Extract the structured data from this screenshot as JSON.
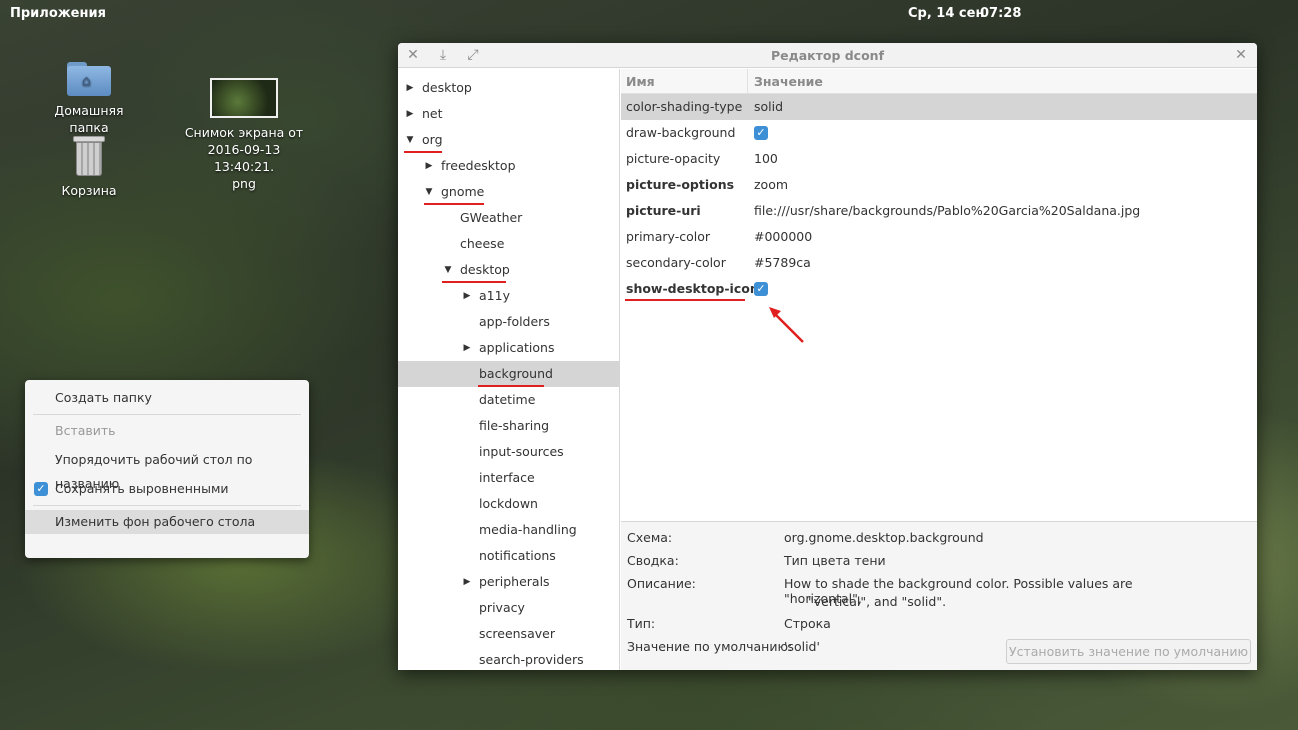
{
  "top_panel": {
    "apps": "Приложения",
    "date": "Ср, 14 сен",
    "time": "07:28"
  },
  "desktop_icons": {
    "home": "Домашняя папка",
    "trash": "Корзина",
    "screenshot_line1": "Снимок экрана от",
    "screenshot_line2": "2016-09-13 13:40:21.",
    "screenshot_line3": "png"
  },
  "context_menu": {
    "create_folder": "Создать папку",
    "paste": "Вставить",
    "arrange": "Упорядочить рабочий стол по названию",
    "keep_aligned": "Сохранять выровненными",
    "change_bg": "Изменить фон рабочего стола"
  },
  "window": {
    "title": "Редактор dconf"
  },
  "tree": [
    "desktop",
    "net",
    "org",
    "freedesktop",
    "gnome",
    "GWeather",
    "cheese",
    "desktop",
    "a11y",
    "app-folders",
    "applications",
    "background",
    "datetime",
    "file-sharing",
    "input-sources",
    "interface",
    "lockdown",
    "media-handling",
    "notifications",
    "peripherals",
    "privacy",
    "screensaver",
    "search-providers"
  ],
  "table": {
    "col_name": "Имя",
    "col_value": "Значение",
    "rows": [
      {
        "key": "color-shading-type",
        "value": "solid"
      },
      {
        "key": "draw-background",
        "value": ""
      },
      {
        "key": "picture-opacity",
        "value": "100"
      },
      {
        "key": "picture-options",
        "value": "zoom"
      },
      {
        "key": "picture-uri",
        "value": "file:///usr/share/backgrounds/Pablo%20Garcia%20Saldana.jpg"
      },
      {
        "key": "primary-color",
        "value": "#000000"
      },
      {
        "key": "secondary-color",
        "value": "#5789ca"
      },
      {
        "key": "show-desktop-icons",
        "value": ""
      }
    ]
  },
  "details": {
    "schema_label": "Схема:",
    "schema_value": "org.gnome.desktop.background",
    "summary_label": "Сводка:",
    "summary_value": "Тип цвета тени",
    "desc_label": "Описание:",
    "desc_value_1": "How to shade the background color. Possible values are \"horizontal\",",
    "desc_value_2": "\"vertical\", and \"solid\".",
    "type_label": "Тип:",
    "type_value": "Строка",
    "default_label": "Значение по умолчанию:",
    "default_value": "'solid'",
    "set_default_button": "Установить значение по умолчанию"
  },
  "colors": {
    "accent": "#3d8fd6",
    "annotation": "#e0201f",
    "selection": "#d5d5d5"
  }
}
